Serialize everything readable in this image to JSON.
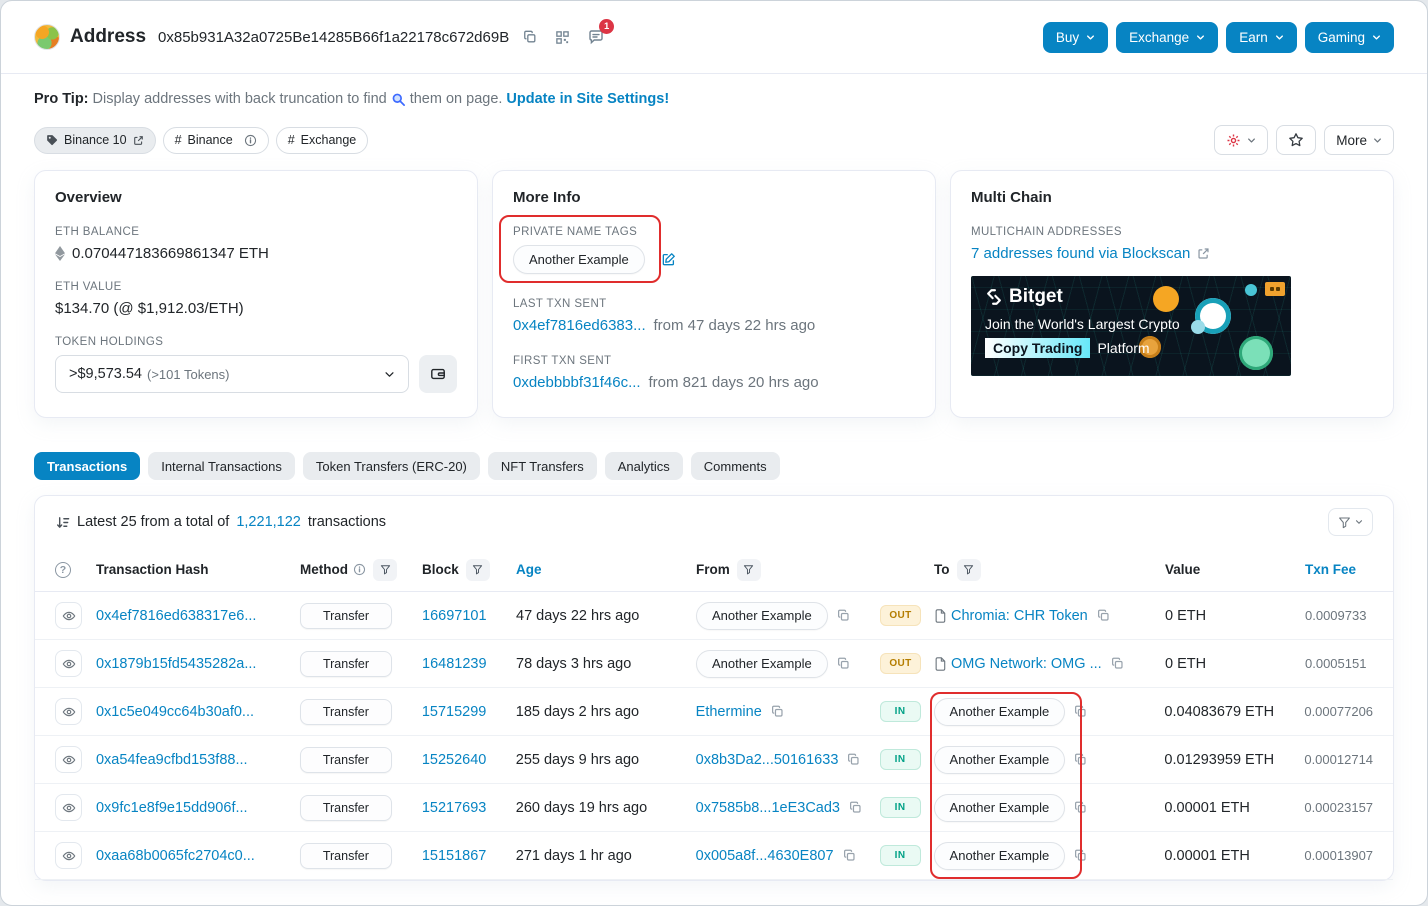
{
  "colors": {
    "accent": "#0784c3",
    "annotation_red": "#e02d2d",
    "in_green": "#00a186",
    "out_amber": "#b47d00",
    "button_blue": "#0784c3"
  },
  "header": {
    "title": "Address",
    "address": "0x85b931A32a0725Be14285B66f1a22178c672d69B",
    "badge_count": "1",
    "buttons": [
      {
        "label": "Buy"
      },
      {
        "label": "Exchange"
      },
      {
        "label": "Earn"
      },
      {
        "label": "Gaming"
      }
    ]
  },
  "protip": {
    "label": "Pro Tip:",
    "text_before": "Display addresses with back truncation to find",
    "text_after": "them on page.",
    "link": "Update in Site Settings!"
  },
  "tags": {
    "primary": "Binance 10",
    "hashtags": [
      {
        "prefix": "#",
        "label": "Binance"
      },
      {
        "prefix": "#",
        "label": "Exchange"
      }
    ],
    "more_label": "More"
  },
  "overview": {
    "title": "Overview",
    "eth_balance_label": "ETH BALANCE",
    "eth_balance": "0.070447183669861347 ETH",
    "eth_value_label": "ETH VALUE",
    "eth_value": "$134.70 (@ $1,912.03/ETH)",
    "token_holdings_label": "TOKEN HOLDINGS",
    "token_value": ">$9,573.54",
    "token_count": "(>101 Tokens)"
  },
  "more_info": {
    "title": "More Info",
    "private_tags_label": "PRIVATE NAME TAGS",
    "private_tag": "Another Example",
    "last_txn_label": "LAST TXN SENT",
    "last_txn_hash": "0x4ef7816ed6383...",
    "last_txn_time": "from 47 days 22 hrs ago",
    "first_txn_label": "FIRST TXN SENT",
    "first_txn_hash": "0xdebbbbf31f46c...",
    "first_txn_time": "from 821 days 20 hrs ago"
  },
  "multichain": {
    "title": "Multi Chain",
    "label": "MULTICHAIN ADDRESSES",
    "link": "7 addresses found via Blockscan"
  },
  "ad": {
    "brand": "Bitget",
    "line1": "Join the World's Largest Crypto",
    "highlight": "Copy Trading",
    "line2_rest": "Platform"
  },
  "tabs": [
    {
      "label": "Transactions"
    },
    {
      "label": "Internal Transactions"
    },
    {
      "label": "Token Transfers (ERC-20)"
    },
    {
      "label": "NFT Transfers"
    },
    {
      "label": "Analytics"
    },
    {
      "label": "Comments"
    }
  ],
  "table": {
    "summary_prefix": "Latest 25 from a total of",
    "summary_count": "1,221,122",
    "summary_suffix": "transactions",
    "headers": {
      "hash": "Transaction Hash",
      "method": "Method",
      "block": "Block",
      "age": "Age",
      "from": "From",
      "to": "To",
      "value": "Value",
      "fee": "Txn Fee"
    },
    "rows": [
      {
        "hash": "0x4ef7816ed638317e6...",
        "method": "Transfer",
        "block": "16697101",
        "age": "47 days 22 hrs ago",
        "from": "Another Example",
        "dir": "OUT",
        "to": "Chromia: CHR Token",
        "value": "0 ETH",
        "fee": "0.0009733"
      },
      {
        "hash": "0x1879b15fd5435282a...",
        "method": "Transfer",
        "block": "16481239",
        "age": "78 days 3 hrs ago",
        "from": "Another Example",
        "dir": "OUT",
        "to": "OMG Network: OMG ...",
        "value": "0 ETH",
        "fee": "0.0005151"
      },
      {
        "hash": "0x1c5e049cc64b30af0...",
        "method": "Transfer",
        "block": "15715299",
        "age": "185 days 2 hrs ago",
        "from": "Ethermine",
        "dir": "IN",
        "to": "Another Example",
        "value": "0.04083679 ETH",
        "fee": "0.00077206"
      },
      {
        "hash": "0xa54fea9cfbd153f88...",
        "method": "Transfer",
        "block": "15252640",
        "age": "255 days 9 hrs ago",
        "from": "0x8b3Da2...50161633",
        "dir": "IN",
        "to": "Another Example",
        "value": "0.01293959 ETH",
        "fee": "0.00012714"
      },
      {
        "hash": "0x9fc1e8f9e15dd906f...",
        "method": "Transfer",
        "block": "15217693",
        "age": "260 days 19 hrs ago",
        "from": "0x7585b8...1eE3Cad3",
        "dir": "IN",
        "to": "Another Example",
        "value": "0.00001 ETH",
        "fee": "0.00023157"
      },
      {
        "hash": "0xaa68b0065fc2704c0...",
        "method": "Transfer",
        "block": "15151867",
        "age": "271 days 1 hr ago",
        "from": "0x005a8f...4630E807",
        "dir": "IN",
        "to": "Another Example",
        "value": "0.00001 ETH",
        "fee": "0.00013907"
      }
    ]
  }
}
